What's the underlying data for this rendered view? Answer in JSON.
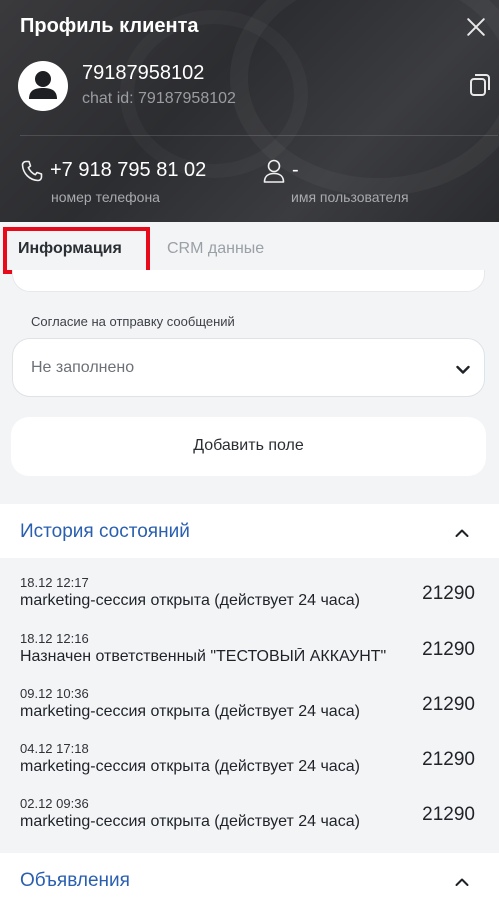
{
  "header": {
    "title": "Профиль клиента",
    "client_name": "79187958102",
    "chat_id": "chat id: 79187958102",
    "phone": "+7 918 795 81 02",
    "phone_caption": "номер телефона",
    "username": "-",
    "username_caption": "имя пользователя"
  },
  "tabs": [
    {
      "label": "Информация",
      "active": true
    },
    {
      "label": "CRM данные",
      "active": false
    }
  ],
  "form": {
    "consent_label": "Согласие на отправку сообщений",
    "consent_value": "Не заполнено",
    "add_field_label": "Добавить поле"
  },
  "history": {
    "title": "История состояний",
    "items": [
      {
        "time": "18.12 12:17",
        "text": "marketing-сессия открыта (действует 24 часа)",
        "id": "21290"
      },
      {
        "time": "18.12 12:16",
        "text": "Назначен ответственный \"ТЕСТОВЫЙ АККАУНТ\"",
        "id": "21290"
      },
      {
        "time": "09.12 10:36",
        "text": "marketing-сессия открыта (действует 24 часа)",
        "id": "21290"
      },
      {
        "time": "04.12 17:18",
        "text": "marketing-сессия открыта (действует 24 часа)",
        "id": "21290"
      },
      {
        "time": "02.12 09:36",
        "text": "marketing-сессия открыта (действует 24 часа)",
        "id": "21290"
      }
    ]
  },
  "ads": {
    "title": "Объявления"
  },
  "colors": {
    "accent_link": "#2a5fb0",
    "highlight": "#e8091a",
    "header_bg": "#333437"
  }
}
